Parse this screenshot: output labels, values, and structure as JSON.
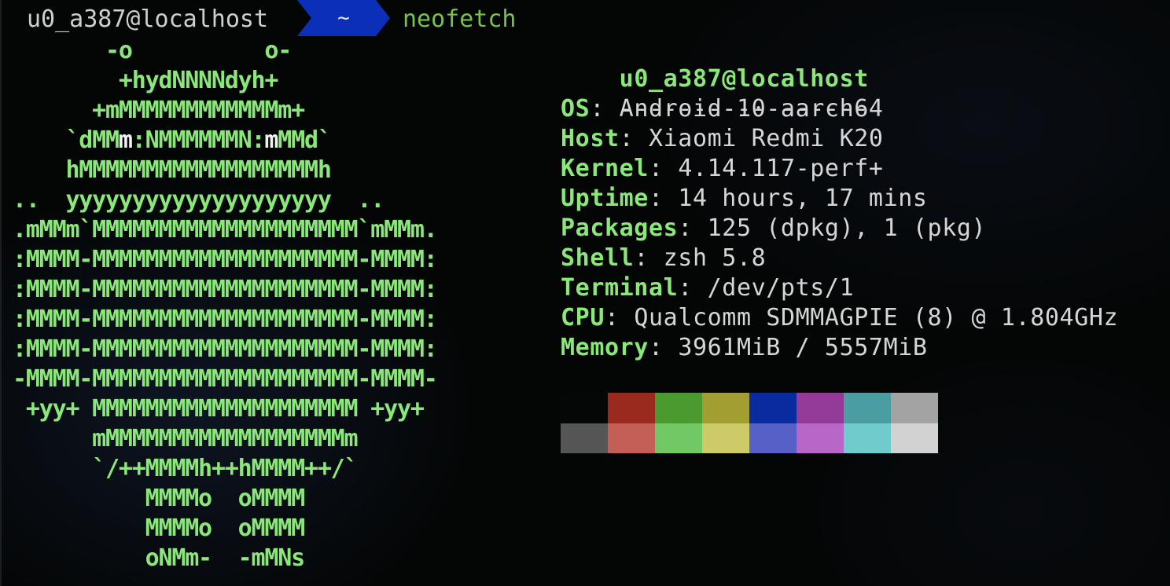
{
  "prompt": {
    "user_host": "u0_a387@localhost",
    "directory": "~",
    "command": "neofetch"
  },
  "logo": {
    "lines": [
      [
        {
          "t": "       -o          o-"
        }
      ],
      [
        {
          "t": "        +hydNNNNdyh+"
        }
      ],
      [
        {
          "t": "      +mMMMMMMMMMMMMm+"
        }
      ],
      [
        {
          "t": "    `dMM"
        },
        {
          "t": "m",
          "w": true
        },
        {
          "t": ":NMMMMMMN:"
        },
        {
          "t": "m",
          "w": true
        },
        {
          "t": "MMd`"
        }
      ],
      [
        {
          "t": "    hMMMMMMMMMMMMMMMMMMh"
        }
      ],
      [
        {
          "t": "..  yyyyyyyyyyyyyyyyyyyy  .."
        }
      ],
      [
        {
          "t": ".mMMm`MMMMMMMMMMMMMMMMMMMM`mMMm."
        }
      ],
      [
        {
          "t": ":MMMM-MMMMMMMMMMMMMMMMMMMM-MMMM:"
        }
      ],
      [
        {
          "t": ":MMMM-MMMMMMMMMMMMMMMMMMMM-MMMM:"
        }
      ],
      [
        {
          "t": ":MMMM-MMMMMMMMMMMMMMMMMMMM-MMMM:"
        }
      ],
      [
        {
          "t": ":MMMM-MMMMMMMMMMMMMMMMMMMM-MMMM:"
        }
      ],
      [
        {
          "t": "-MMMM-MMMMMMMMMMMMMMMMMMMM-MMMM-"
        }
      ],
      [
        {
          "t": " +yy+ MMMMMMMMMMMMMMMMMMMM +yy+"
        }
      ],
      [
        {
          "t": "      mMMMMMMMMMMMMMMMMMMm"
        }
      ],
      [
        {
          "t": "      `/++MMMMh++hMMMM++/`"
        }
      ],
      [
        {
          "t": "          MMMMo  oMMMM"
        }
      ],
      [
        {
          "t": "          MMMMo  oMMMM"
        }
      ],
      [
        {
          "t": "          oNMm-  -mMNs"
        }
      ]
    ]
  },
  "info": {
    "title": "u0_a387@localhost",
    "separator": "-----------------",
    "rows": [
      {
        "key": "OS",
        "value": "Android 10 aarch64"
      },
      {
        "key": "Host",
        "value": "Xiaomi Redmi K20"
      },
      {
        "key": "Kernel",
        "value": "4.14.117-perf+"
      },
      {
        "key": "Uptime",
        "value": "14 hours, 17 mins"
      },
      {
        "key": "Packages",
        "value": "125 (dpkg), 1 (pkg)"
      },
      {
        "key": "Shell",
        "value": "zsh 5.8"
      },
      {
        "key": "Terminal",
        "value": "/dev/pts/1"
      },
      {
        "key": "CPU",
        "value": "Qualcomm SDMMAGPIE (8) @ 1.804GHz"
      },
      {
        "key": "Memory",
        "value": "3961MiB / 5557MiB"
      }
    ]
  },
  "colors": {
    "accent_green": "#8ae879",
    "prompt_segment": "#0b2fb8",
    "palette_normal": [
      "#050707",
      "#9b2a1e",
      "#4a9a2f",
      "#a29e32",
      "#0a2aa0",
      "#943b99",
      "#4a9ea1",
      "#a3a3a3"
    ],
    "palette_bright": [
      "#555555",
      "#c45f58",
      "#72c864",
      "#cdcb68",
      "#5660c6",
      "#b866c7",
      "#6fcbcc",
      "#d2d2d2"
    ]
  }
}
